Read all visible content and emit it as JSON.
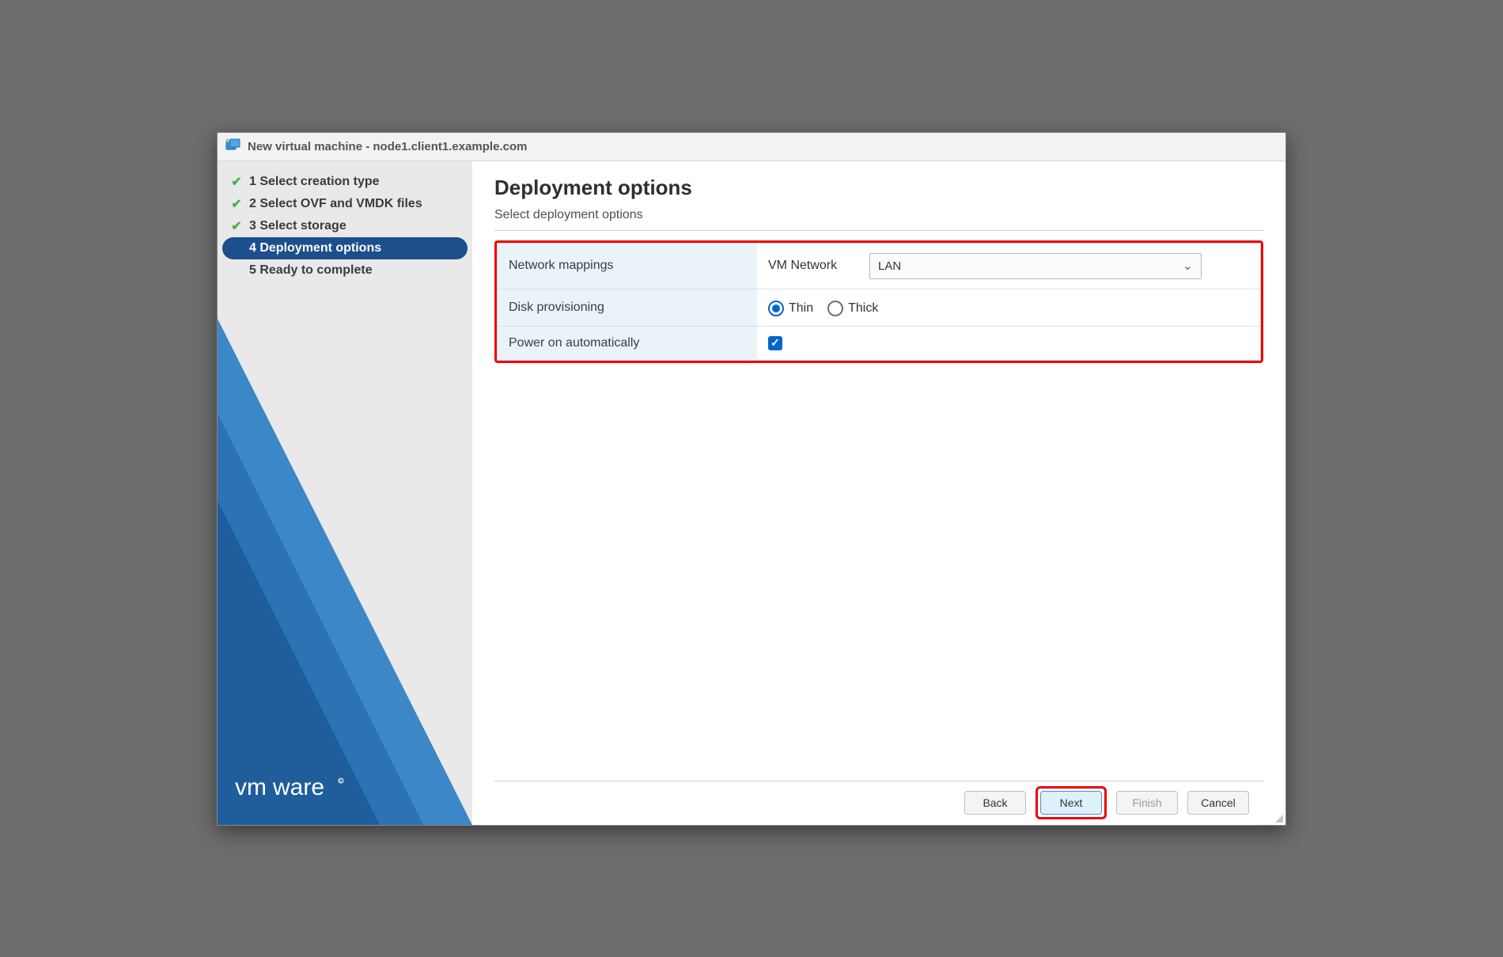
{
  "window": {
    "title": "New virtual machine - node1.client1.example.com"
  },
  "sidebar": {
    "steps": [
      {
        "label": "1 Select creation type",
        "state": "done"
      },
      {
        "label": "2 Select OVF and VMDK files",
        "state": "done"
      },
      {
        "label": "3 Select storage",
        "state": "done"
      },
      {
        "label": "4 Deployment options",
        "state": "active"
      },
      {
        "label": "5 Ready to complete",
        "state": "upcoming"
      }
    ],
    "brand": "vmware"
  },
  "page": {
    "title": "Deployment options",
    "subtitle": "Select deployment options"
  },
  "options": {
    "network_mappings": {
      "label": "Network mappings",
      "source": "VM Network",
      "selected": "LAN"
    },
    "disk_provisioning": {
      "label": "Disk provisioning",
      "options": [
        "Thin",
        "Thick"
      ],
      "selected": "Thin"
    },
    "power_on": {
      "label": "Power on automatically",
      "checked": true
    }
  },
  "footer": {
    "back": "Back",
    "next": "Next",
    "finish": "Finish",
    "cancel": "Cancel"
  }
}
